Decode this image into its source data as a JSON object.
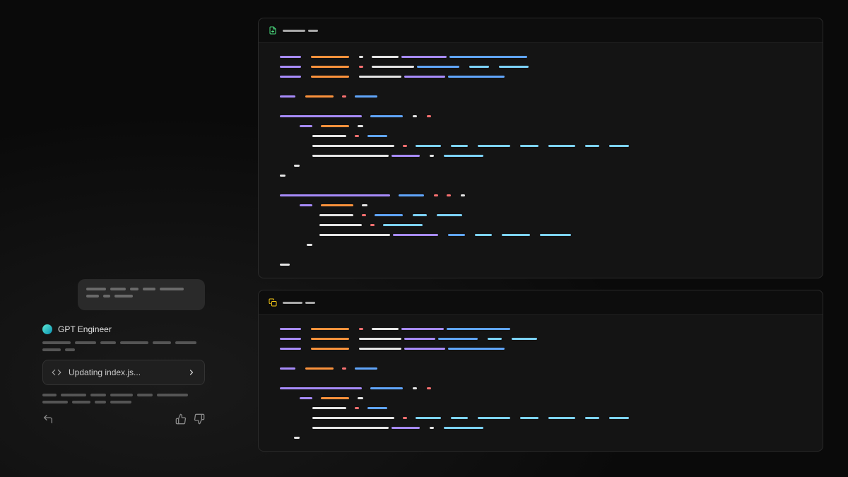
{
  "chat": {
    "assistant_name": "GPT Engineer",
    "action_label": "Updating index.js..."
  },
  "code": {
    "file1_type": "create",
    "file2_type": "edit"
  }
}
